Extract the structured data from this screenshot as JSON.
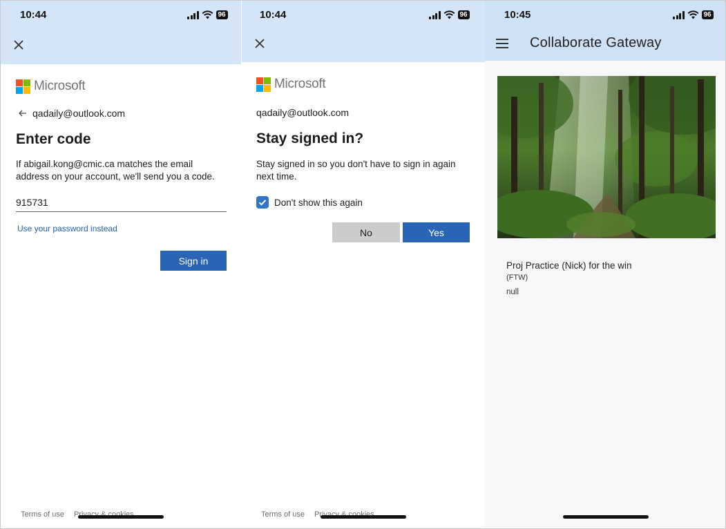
{
  "screens": [
    {
      "status": {
        "time": "10:44",
        "battery": "96"
      },
      "brand": "Microsoft",
      "email": "qadaily@outlook.com",
      "heading": "Enter code",
      "message_line1": "If abigail.kong@cmic.ca matches the email",
      "message_line2": "address on your account, we'll send you a code.",
      "code_value": "915731",
      "alt_link": "Use your password instead",
      "sign_in_label": "Sign in",
      "footer": {
        "terms": "Terms of use",
        "privacy": "Privacy & cookies"
      }
    },
    {
      "status": {
        "time": "10:44",
        "battery": "96"
      },
      "brand": "Microsoft",
      "email": "qadaily@outlook.com",
      "heading": "Stay signed in?",
      "message_line1": "Stay signed in so you don't have to sign in again",
      "message_line2": "next time.",
      "checkbox_label": "Don't show this again",
      "checkbox_checked": true,
      "no_label": "No",
      "yes_label": "Yes",
      "footer": {
        "terms": "Terms of use",
        "privacy": "Privacy & cookies"
      }
    },
    {
      "status": {
        "time": "10:45",
        "battery": "96"
      },
      "title": "Collaborate Gateway",
      "card": {
        "title": "Proj Practice (Nick) for the win",
        "subtitle": "(FTW)",
        "detail": "null"
      }
    }
  ],
  "colors": {
    "header_bg": "#d4e5f8",
    "primary_button": "#2a64b5",
    "secondary_button": "#cccccc",
    "link": "#1f5fb0",
    "ms_red": "#f25022",
    "ms_green": "#7fba00",
    "ms_blue": "#00a4ef",
    "ms_yellow": "#ffb900"
  },
  "icons": {
    "close": "close-icon",
    "back": "arrow-left-icon",
    "menu": "hamburger-menu-icon",
    "signal": "cellular-signal-icon",
    "wifi": "wifi-icon",
    "battery": "battery-icon",
    "check": "checkmark-icon"
  }
}
